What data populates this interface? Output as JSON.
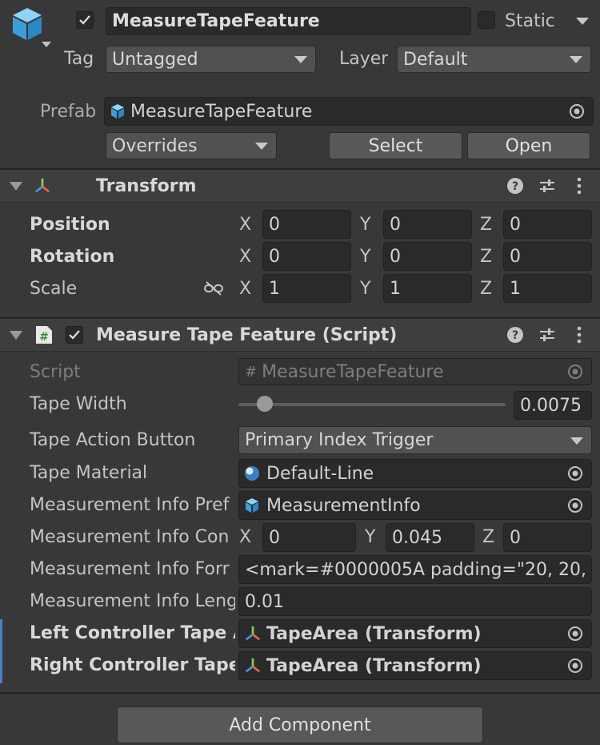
{
  "object": {
    "name": "MeasureTapeFeature",
    "static_label": "Static",
    "tag_label": "Tag",
    "tag_value": "Untagged",
    "layer_label": "Layer",
    "layer_value": "Default",
    "prefab_label": "Prefab",
    "prefab_value": "MeasureTapeFeature",
    "overrides_label": "Overrides",
    "select_label": "Select",
    "open_label": "Open"
  },
  "transform": {
    "title": "Transform",
    "rows": [
      {
        "label": "Position",
        "x": "0",
        "y": "0",
        "z": "0"
      },
      {
        "label": "Rotation",
        "x": "0",
        "y": "0",
        "z": "0"
      },
      {
        "label": "Scale",
        "x": "1",
        "y": "1",
        "z": "1"
      }
    ],
    "axes": {
      "x": "X",
      "y": "Y",
      "z": "Z"
    }
  },
  "script": {
    "title": "Measure Tape Feature (Script)",
    "script_label": "Script",
    "script_value": "MeasureTapeFeature",
    "tape_width_label": "Tape Width",
    "tape_width_value": "0.0075",
    "tape_width_slider_fraction": 0.1,
    "tape_action_label": "Tape Action Button",
    "tape_action_value": "Primary Index Trigger",
    "tape_material_label": "Tape Material",
    "tape_material_value": "Default-Line",
    "mi_prefab_label": "Measurement Info Pref",
    "mi_prefab_value": "MeasurementInfo",
    "mi_con_label": "Measurement Info Con",
    "mi_con_x": "0",
    "mi_con_y": "0.045",
    "mi_con_z": "0",
    "mi_format_label": "Measurement Info Forr",
    "mi_format_value": "<mark=#0000005A padding=\"20, 20,",
    "mi_length_label": "Measurement Info Leng",
    "mi_length_value": "0.01",
    "left_label": "Left Controller Tape A",
    "left_value": "TapeArea (Transform)",
    "right_label": "Right Controller Tape /",
    "right_value": "TapeArea (Transform)"
  },
  "add_component_label": "Add Component",
  "colors": {
    "accent": "#4c7fbf",
    "background": "#383838",
    "field": "#2a2a2a"
  }
}
